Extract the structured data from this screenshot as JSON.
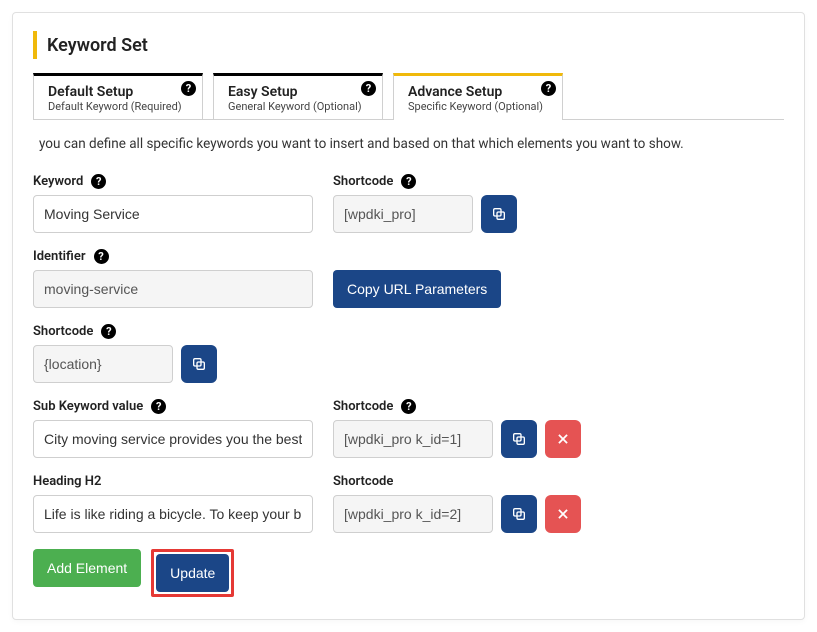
{
  "section": {
    "title": "Keyword Set"
  },
  "tabs": [
    {
      "title": "Default Setup",
      "sub": "Default Keyword (Required)"
    },
    {
      "title": "Easy Setup",
      "sub": "General Keyword (Optional)"
    },
    {
      "title": "Advance Setup",
      "sub": "Specific Keyword (Optional)"
    }
  ],
  "description": "you can define all specific keywords you want to insert and based on that which elements you want to show.",
  "labels": {
    "keyword": "Keyword",
    "shortcode": "Shortcode",
    "identifier": "Identifier",
    "sub_keyword": "Sub Keyword value",
    "heading_h2": "Heading H2"
  },
  "values": {
    "keyword": "Moving Service",
    "shortcode_main": "[wpdki_pro]",
    "identifier": "moving-service",
    "shortcode_location": "{location}",
    "sub_keyword": "City moving service provides you the best of services",
    "shortcode_sub": "[wpdki_pro k_id=1]",
    "heading_h2": "Life is like riding a bicycle. To keep your balance you must keep moving",
    "shortcode_h2": "[wpdki_pro k_id=2]"
  },
  "buttons": {
    "copy_url": "Copy URL Parameters",
    "add_element": "Add Element",
    "update": "Update"
  },
  "help_char": "?"
}
